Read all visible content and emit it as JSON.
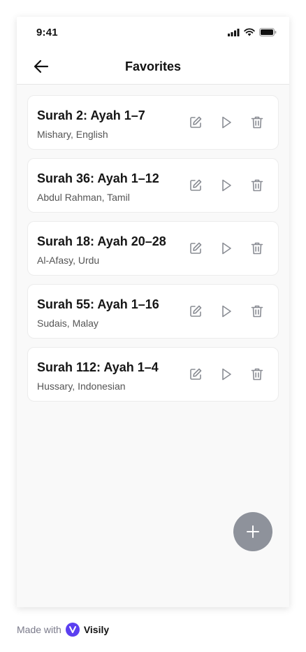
{
  "status_bar": {
    "time": "9:41"
  },
  "header": {
    "title": "Favorites"
  },
  "favorites": [
    {
      "title": "Surah 2: Ayah 1–7",
      "subtitle": "Mishary, English"
    },
    {
      "title": "Surah 36: Ayah 1–12",
      "subtitle": "Abdul Rahman, Tamil"
    },
    {
      "title": "Surah 18: Ayah 20–28",
      "subtitle": "Al-Afasy, Urdu"
    },
    {
      "title": "Surah 55: Ayah 1–16",
      "subtitle": "Sudais, Malay"
    },
    {
      "title": "Surah 112: Ayah 1–4",
      "subtitle": "Hussary, Indonesian"
    }
  ],
  "icons": {
    "back": "arrow-left-icon",
    "edit": "edit-icon",
    "play": "play-icon",
    "delete": "trash-icon",
    "add": "plus-icon"
  },
  "colors": {
    "fab": "#8e929b",
    "icon": "#8a8d94",
    "background": "#f9f9f9",
    "card": "#ffffff",
    "brand": "#5b3ff0"
  },
  "footer": {
    "made_with": "Made with",
    "brand": "Visily"
  }
}
